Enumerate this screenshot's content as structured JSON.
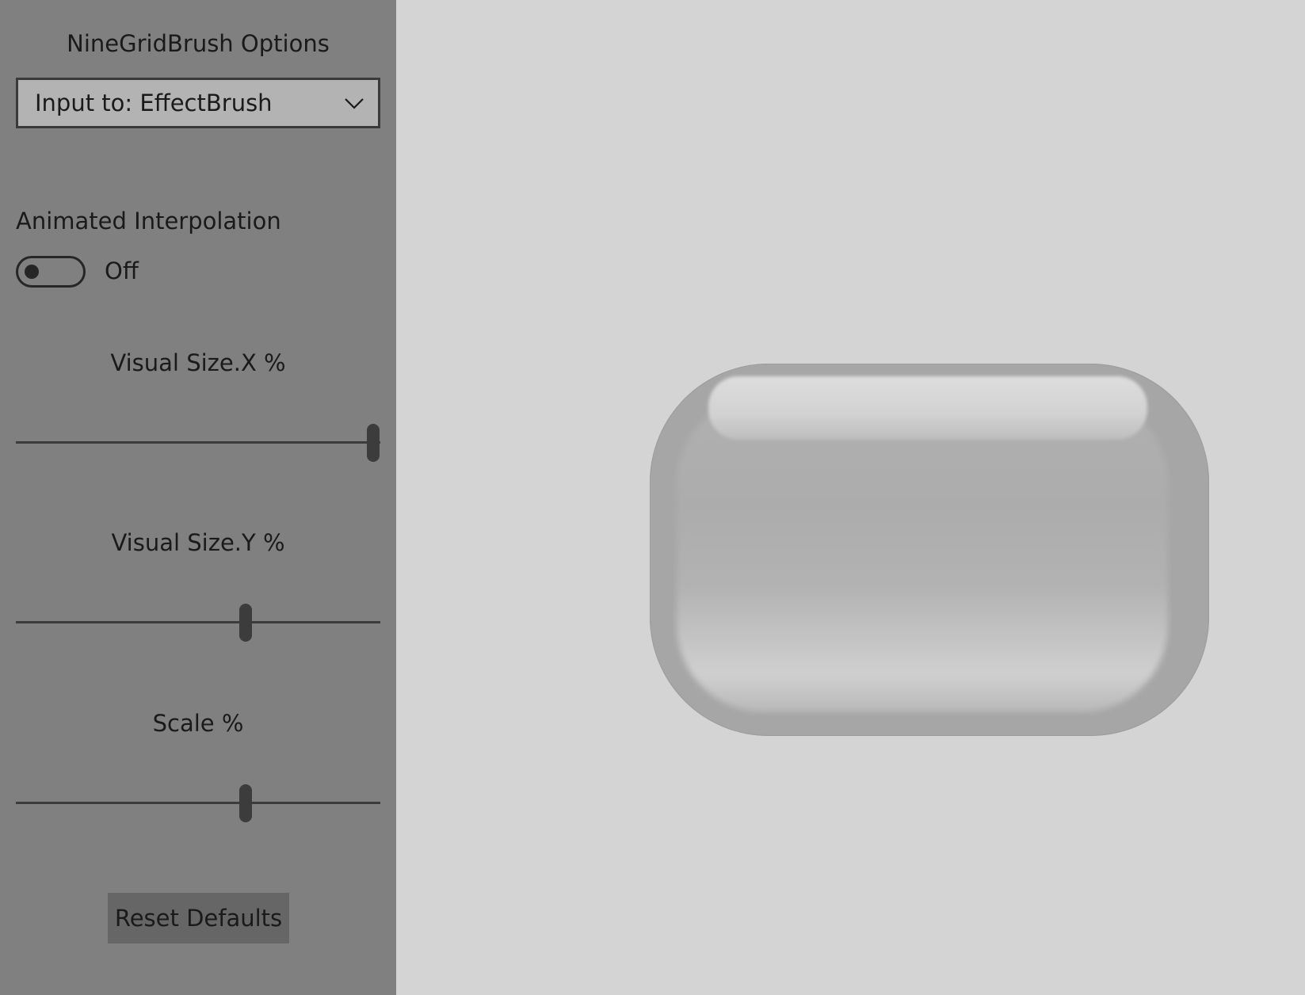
{
  "panel": {
    "title": "NineGridBrush Options",
    "input_dropdown": {
      "selected": "Input to: EffectBrush"
    },
    "animated_interpolation": {
      "label": "Animated Interpolation",
      "state": "Off",
      "on": false
    },
    "sliders": [
      {
        "label": "Visual Size.X %",
        "value_fraction": 0.98
      },
      {
        "label": "Visual Size.Y %",
        "value_fraction": 0.63
      },
      {
        "label": "Scale %",
        "value_fraction": 0.63
      }
    ],
    "reset_button": "Reset Defaults"
  },
  "icons": {
    "dropdown": "chevron-down-icon"
  },
  "colors": {
    "sidebar_bg": "#808080",
    "canvas_bg": "#d4d4d4",
    "button_bg": "#666666",
    "pill": "#a6a6a6"
  }
}
